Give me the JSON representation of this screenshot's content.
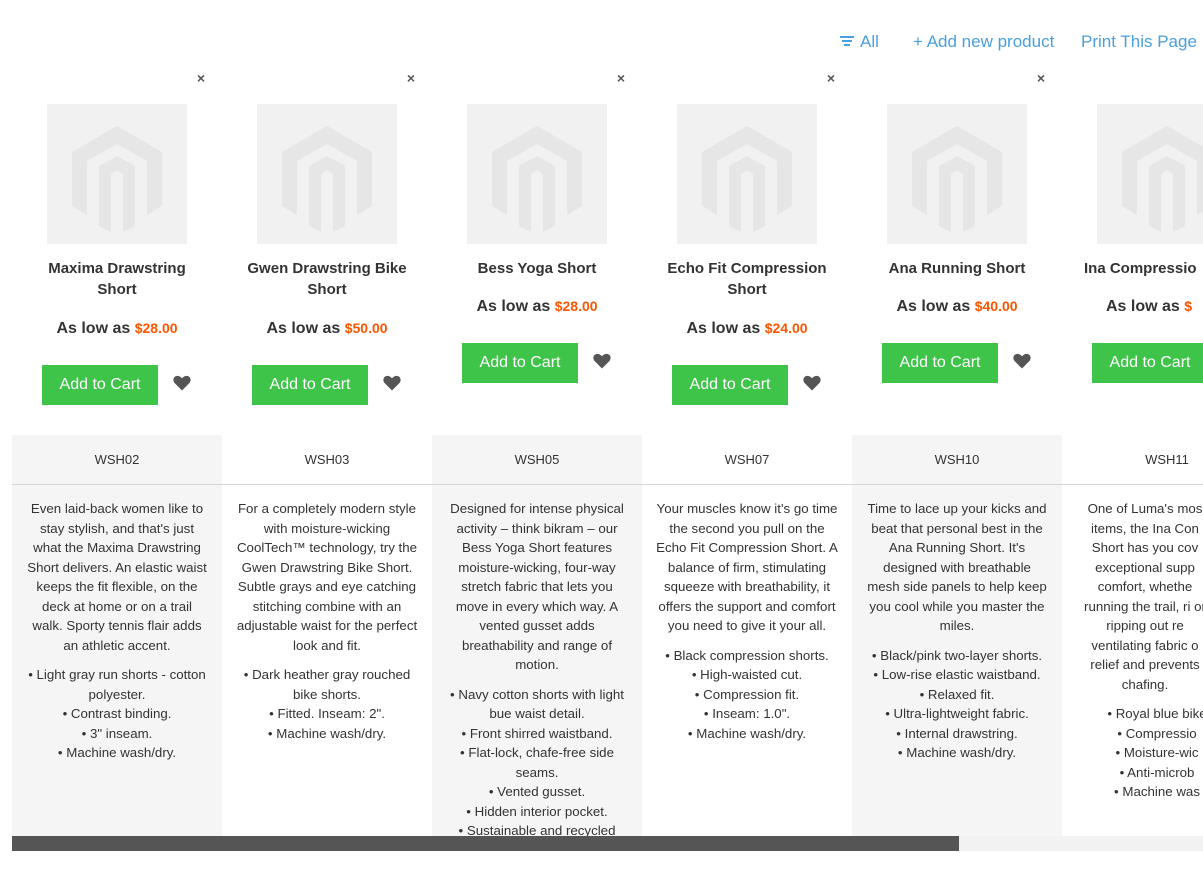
{
  "toolbar": {
    "all_label": "All",
    "add_label": "+ Add new product",
    "print_label": "Print This Page"
  },
  "remove_symbol": "×",
  "price_prefix": "As low as",
  "cart_label": "Add to Cart",
  "products": [
    {
      "name": "Maxima Drawstring Short",
      "price": "$28.00",
      "sku": "WSH02",
      "description": "Even laid-back women like to stay stylish, and that's just what the Maxima Drawstring Short delivers. An elastic waist keeps the fit flexible, on the deck at home or on a trail walk. Sporty tennis flair adds an athletic accent.",
      "features": [
        "• Light gray run shorts - cotton polyester.",
        "• Contrast binding.",
        "• 3\" inseam.",
        "• Machine wash/dry."
      ]
    },
    {
      "name": "Gwen Drawstring Bike Short",
      "price": "$50.00",
      "sku": "WSH03",
      "description": "For a completely modern style with moisture-wicking CoolTech™ technology, try the Gwen Drawstring Bike Short. Subtle grays and eye catching stitching combine with an adjustable waist for the perfect look and fit.",
      "features": [
        "• Dark heather gray rouched bike shorts.",
        "• Fitted. Inseam: 2\".",
        "• Machine wash/dry."
      ]
    },
    {
      "name": "Bess Yoga Short",
      "price": "$28.00",
      "sku": "WSH05",
      "description": "Designed for intense physical activity – think bikram – our Bess Yoga Short features moisture-wicking, four-way stretch fabric that lets you move in every which way. A vented gusset adds breathability and range of motion.",
      "features": [
        "• Navy cotton shorts with light bue waist detail.",
        "• Front shirred waistband.",
        "• Flat-lock, chafe-free side seams.",
        "• Vented gusset.",
        "• Hidden interior pocket.",
        "• Sustainable and recycled"
      ]
    },
    {
      "name": "Echo Fit Compression Short",
      "price": "$24.00",
      "sku": "WSH07",
      "description": "Your muscles know it's go time the second you pull on the Echo Fit Compression Short. A balance of firm, stimulating squeeze with breathability, it offers the support and comfort you need to give it your all.",
      "features": [
        "• Black compression shorts.",
        "• High-waisted cut.",
        "• Compression fit.",
        "• Inseam: 1.0\".",
        "• Machine wash/dry."
      ]
    },
    {
      "name": "Ana Running Short",
      "price": "$40.00",
      "sku": "WSH10",
      "description": "Time to lace up your kicks and beat that personal best in the Ana Running Short. It's designed with breathable mesh side panels to help keep you cool while you master the miles.",
      "features": [
        "• Black/pink two-layer shorts.",
        "• Low-rise elastic waistband.",
        "• Relaxed fit.",
        "• Ultra-lightweight fabric.",
        "• Internal drawstring.",
        "• Machine wash/dry."
      ]
    },
    {
      "name": "Ina Compressio",
      "price": "$",
      "sku": "WSH11",
      "description": "One of Luma's mos items, the Ina Con Short has you cov exceptional supp comfort, whethe running the trail, ri or ripping out re ventilating fabric o relief and prevents chafing.",
      "features": [
        "• Royal blue bike",
        "• Compressio",
        "• Moisture-wic",
        "• Anti-microb",
        "• Machine was"
      ]
    }
  ],
  "scroll_position": 0.0,
  "scroll_visible_fraction": 0.795
}
